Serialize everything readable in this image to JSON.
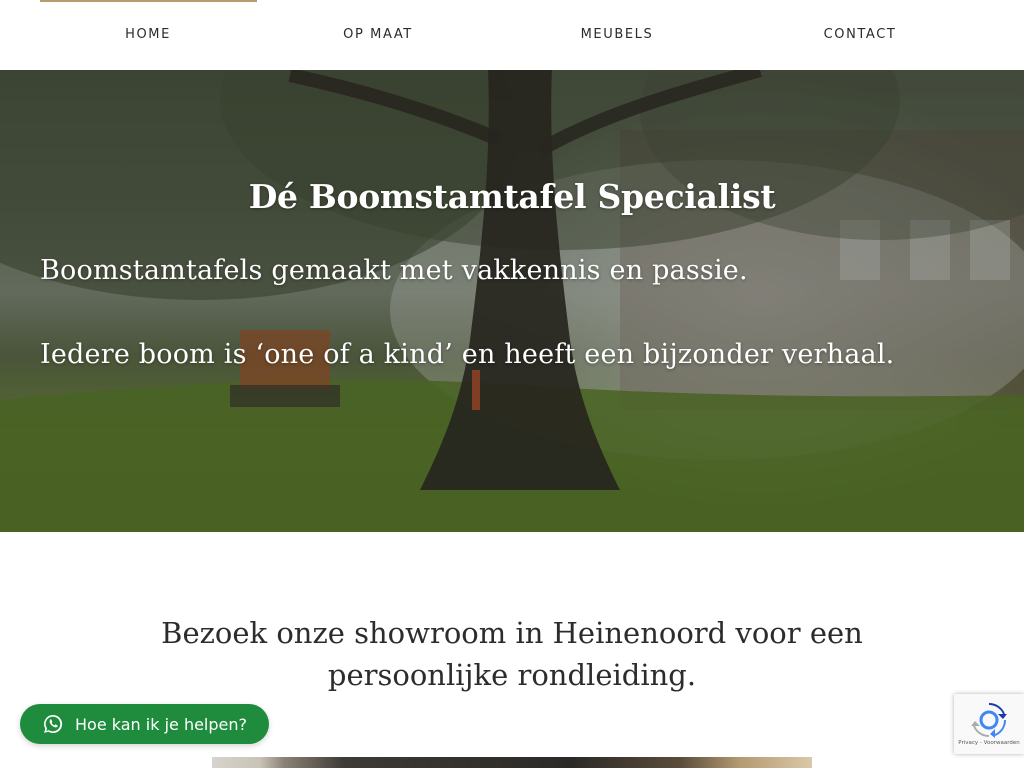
{
  "nav": {
    "items": [
      {
        "label": "HOME",
        "active": true
      },
      {
        "label": "OP MAAT"
      },
      {
        "label": "MEUBELS"
      },
      {
        "label": "CONTACT"
      }
    ],
    "active_color": "#b89a6c"
  },
  "hero": {
    "title": "Dé Boomstamtafel Specialist",
    "line_1": "Boomstamtafels gemaakt met vakkennis en passie.",
    "line_2": "Iedere boom is ‘one of a kind’ en heeft een bijzonder verhaal."
  },
  "showroom": {
    "heading": "Bezoek onze showroom in Heinenoord voor een persoonlijke rondleiding."
  },
  "chat": {
    "label": "Hoe kan ik je helpen?",
    "icon": "whatsapp-icon",
    "color": "#1e8c3c"
  },
  "recaptcha": {
    "footer": "Privacy - Voorwaarden",
    "icon": "recaptcha-icon"
  }
}
